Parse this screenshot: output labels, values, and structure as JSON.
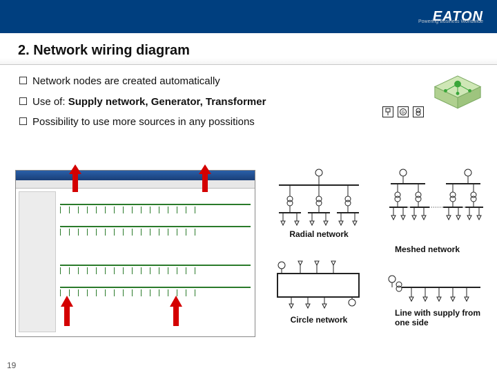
{
  "brand": {
    "name": "EATON",
    "tagline": "Powering Business Worldwide"
  },
  "title": "2. Network wiring diagram",
  "bullets": [
    {
      "text": "Network nodes are created automatically",
      "bold": false
    },
    {
      "prefix": "Use of: ",
      "bold_text": "Supply network, Generator, Transformer"
    },
    {
      "text": "Possibility to use more sources in any possitions",
      "bold": false
    }
  ],
  "icons": [
    {
      "name": "supply-network-icon",
      "glyph": "⏚"
    },
    {
      "name": "generator-icon",
      "glyph": "G"
    },
    {
      "name": "transformer-icon",
      "glyph": "⧗"
    }
  ],
  "diagrams": {
    "radial": "Radial network",
    "meshed": "Meshed network",
    "circle": "Circle network",
    "line": "Line with supply from one side"
  },
  "page_number": "19"
}
